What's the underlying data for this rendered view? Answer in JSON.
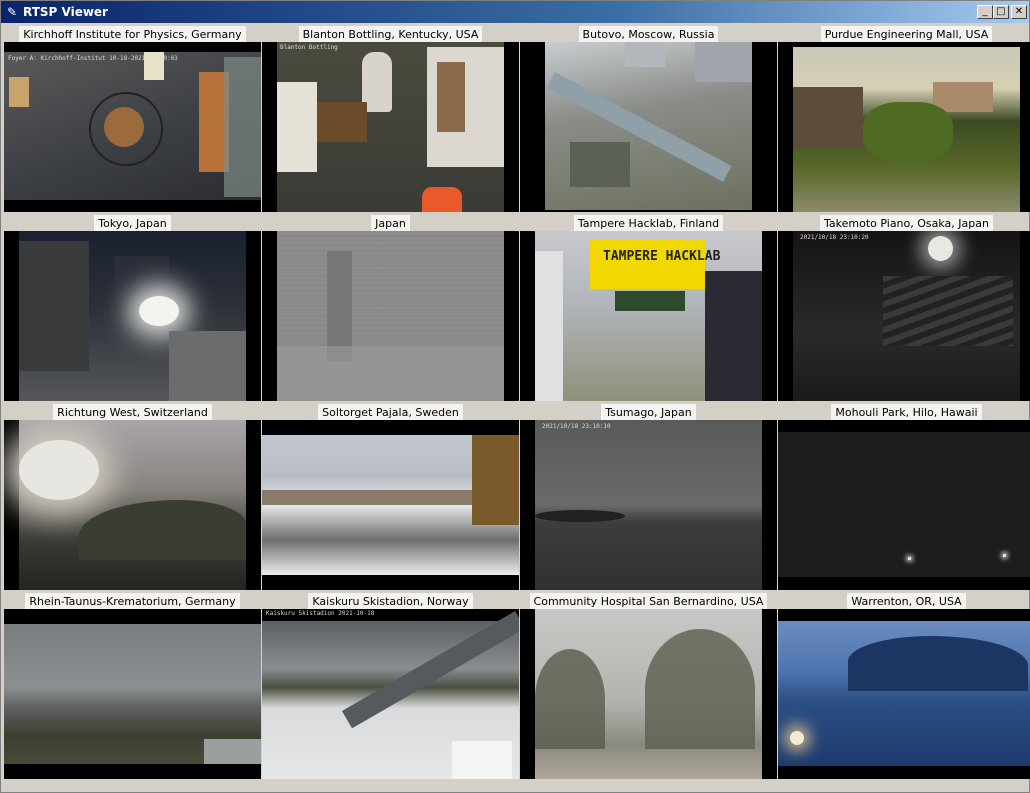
{
  "window": {
    "title": "RTSP Viewer",
    "app_icon": "feather-icon",
    "buttons": {
      "minimize": "_",
      "maximize": "□",
      "close": "✕"
    }
  },
  "cameras": [
    {
      "label": "Kirchhoff Institute for Physics, Germany",
      "overlay": "Foyer A: Kirchhoff-Institut   10-18-2021 16:10:03"
    },
    {
      "label": "Blanton Bottling, Kentucky, USA",
      "overlay": "Blanton Bottling"
    },
    {
      "label": "Butovo, Moscow, Russia",
      "overlay": ""
    },
    {
      "label": "Purdue Engineering Mall, USA",
      "overlay": ""
    },
    {
      "label": "Tokyo, Japan",
      "overlay": ""
    },
    {
      "label": "Japan",
      "overlay": ""
    },
    {
      "label": "Tampere Hacklab, Finland",
      "overlay": "TAMPERE HACKLAB"
    },
    {
      "label": "Takemoto Piano, Osaka, Japan",
      "overlay": "2021/10/18  23:10:20"
    },
    {
      "label": "Richtung West, Switzerland",
      "overlay": ""
    },
    {
      "label": "Soltorget Pajala, Sweden",
      "overlay": ""
    },
    {
      "label": "Tsumago, Japan",
      "overlay": "2021/10/18  23:10:10"
    },
    {
      "label": "Mohouli Park, Hilo, Hawaii",
      "overlay": ""
    },
    {
      "label": "Rhein-Taunus-Krematorium, Germany",
      "overlay": ""
    },
    {
      "label": "Kaiskuru Skistadion, Norway",
      "overlay": "Kaiskuru Skistadion  2021-10-18"
    },
    {
      "label": "Community Hospital San Bernardino, USA",
      "overlay": ""
    },
    {
      "label": "Warrenton, OR, USA",
      "overlay": ""
    }
  ]
}
